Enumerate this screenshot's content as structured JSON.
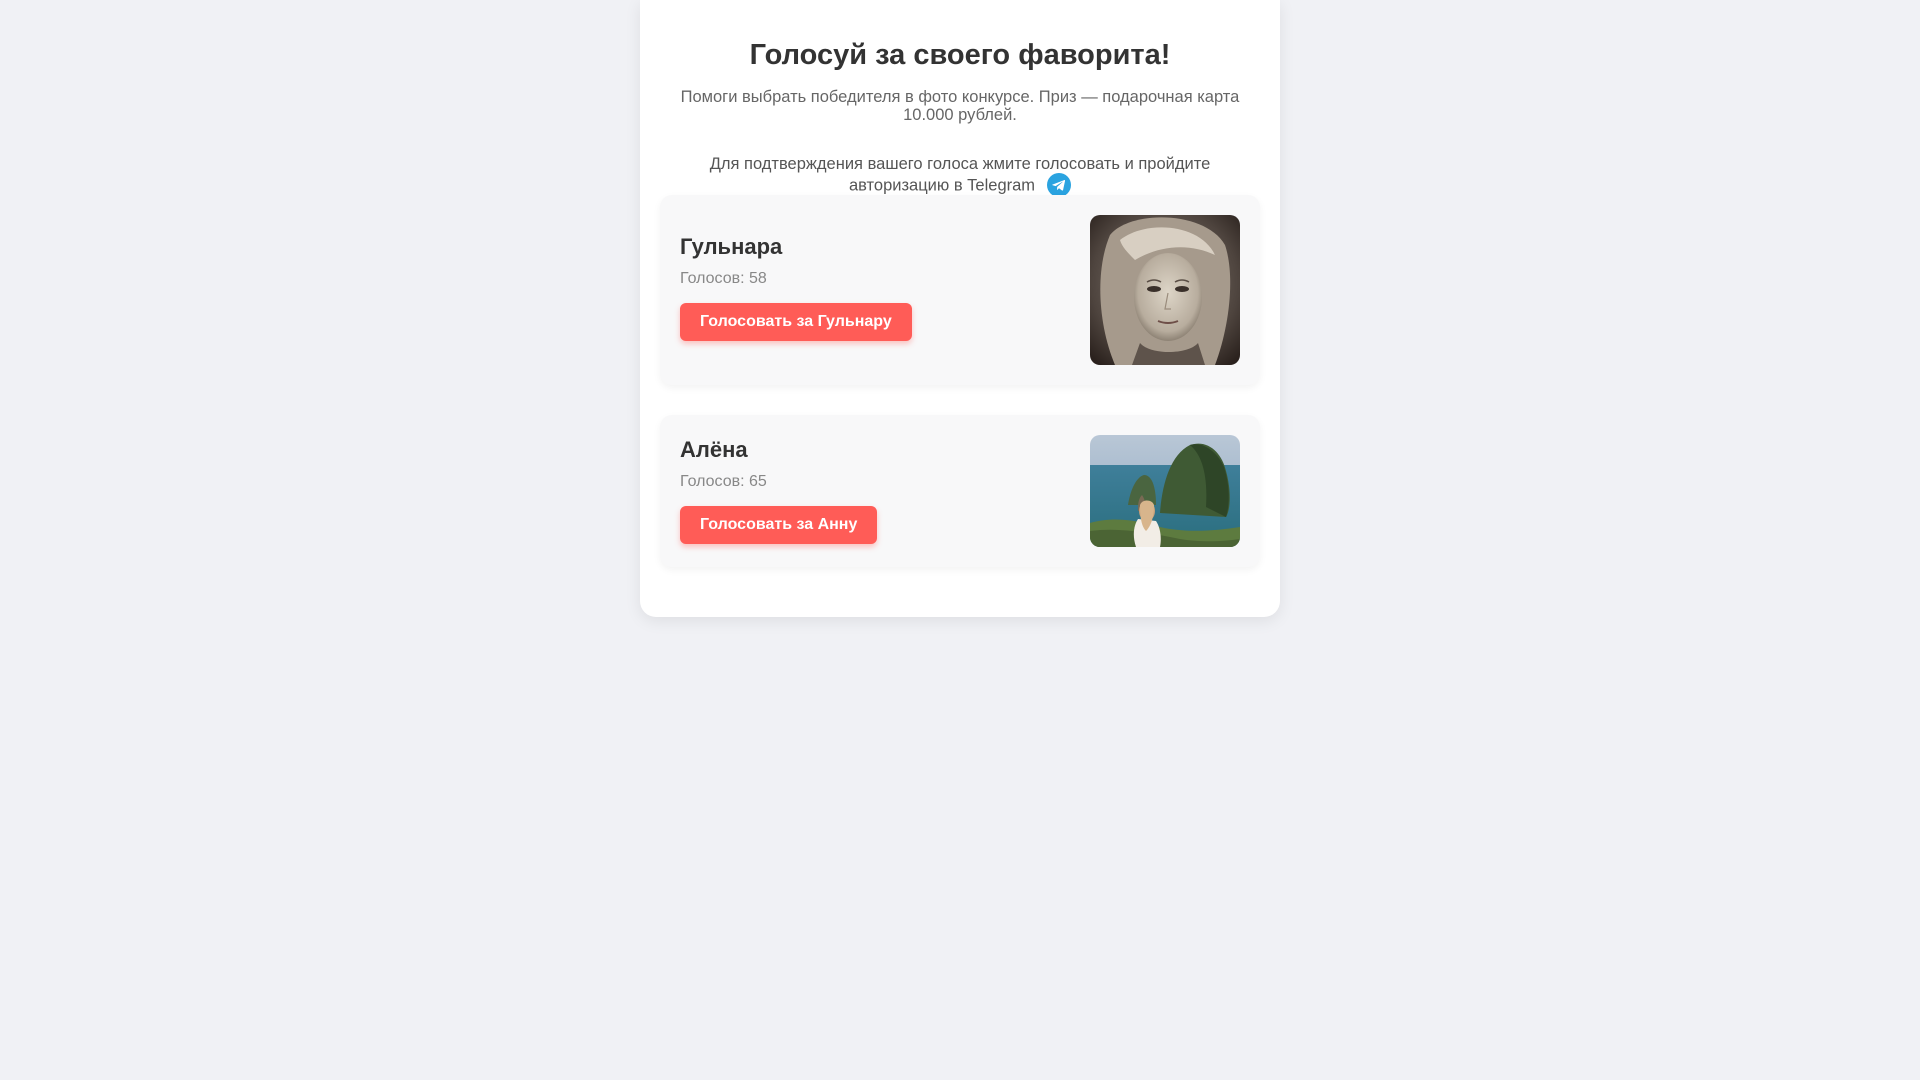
{
  "header": {
    "title": "Голосуй за своего фаворита!",
    "subtitle": "Помоги выбрать победителя в фото конкурсе. Приз — подарочная карта 10.000 рублей.",
    "instruction": "Для подтверждения вашего голоса жмите голосовать и пройдите авторизацию в Telegram",
    "telegram_icon": "telegram-icon",
    "telegram_color": "#2aa3e0"
  },
  "candidates": [
    {
      "name": "Гульнара",
      "votes_text": "Голосов: 58",
      "button_label": "Голосовать за Гульнару",
      "photo": "portrait-photo"
    },
    {
      "name": "Алёна",
      "votes_text": "Голосов: 65",
      "button_label": "Голосовать за Анну",
      "photo": "seaside-cliff-photo"
    }
  ],
  "colors": {
    "button": "#ff5c57",
    "background": "#f0f1f5",
    "card": "#f8f8f9"
  }
}
